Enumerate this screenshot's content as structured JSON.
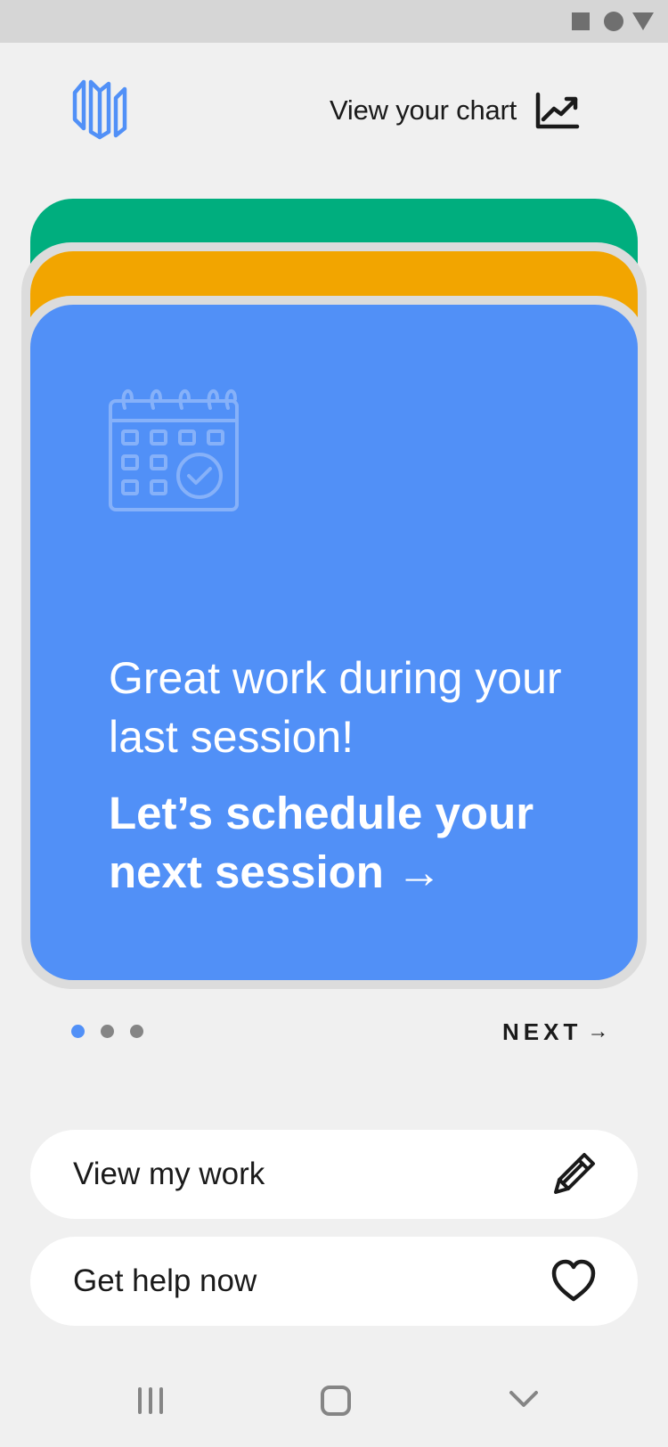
{
  "status_bar": {
    "icons": [
      "square-icon",
      "circle-icon",
      "triangle-icon"
    ]
  },
  "header": {
    "logo_icon": "brand-logo",
    "chart_link_label": "View your chart",
    "chart_link_icon": "trending-up-chart-icon"
  },
  "carousel": {
    "cards": [
      {
        "color": "#00ae7e"
      },
      {
        "color": "#f2a500"
      },
      {
        "color": "#5190f7",
        "icon": "calendar-check-icon",
        "message": "Great work during your last session!",
        "cta_label": "Let’s schedule your next session →"
      }
    ],
    "pagination": {
      "count": 3,
      "active_index": 0
    },
    "next_label": "NEXT",
    "next_arrow": "→"
  },
  "actions": [
    {
      "label": "View my work",
      "icon": "pencil-icon"
    },
    {
      "label": "Get help now",
      "icon": "heart-icon"
    }
  ],
  "nav_bar": {
    "icons": [
      "recent-apps-icon",
      "home-icon",
      "back-chevron-icon"
    ]
  },
  "colors": {
    "background": "#f0f0f0",
    "accent_blue": "#5190f7",
    "green": "#00ae7e",
    "orange": "#f2a500",
    "text_dark": "#1a1a1a"
  }
}
